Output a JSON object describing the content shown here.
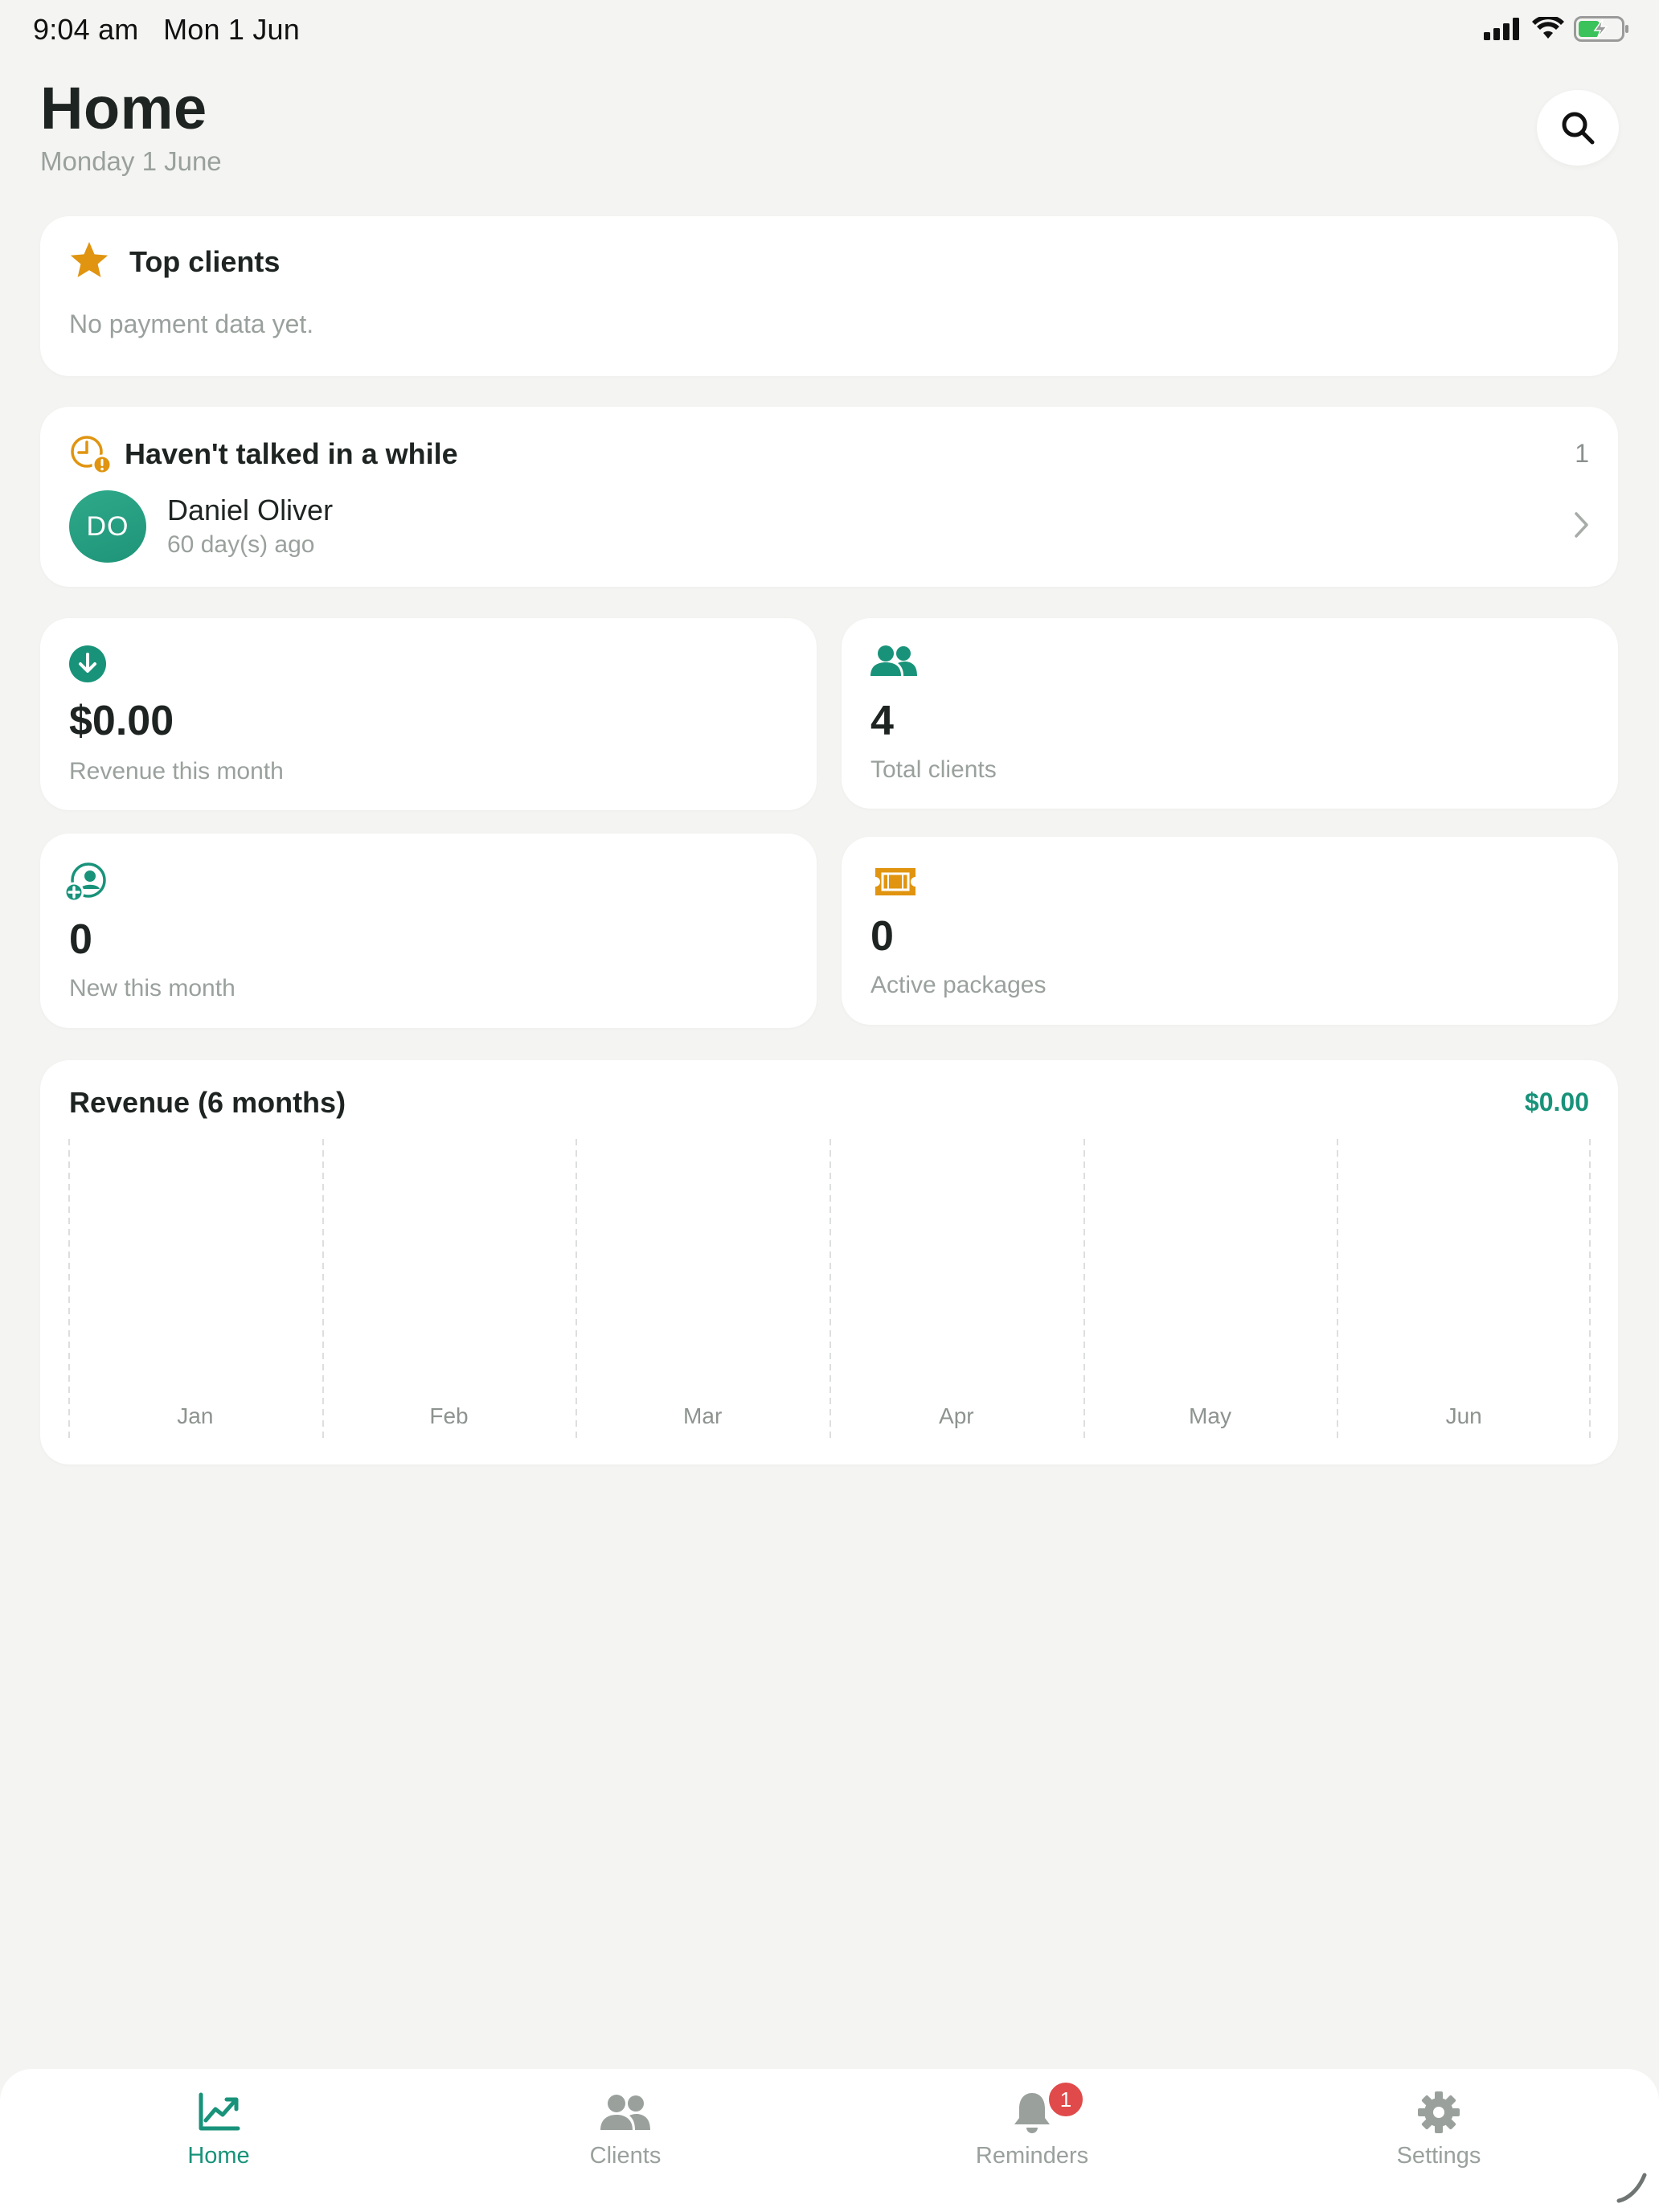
{
  "status_bar": {
    "time": "9:04 am",
    "date": "Mon 1 Jun",
    "icons": [
      "cellular-signal-icon",
      "wifi-icon",
      "battery-charging-icon"
    ]
  },
  "header": {
    "title": "Home",
    "subtitle": "Monday 1 June",
    "search_icon": "search-icon"
  },
  "top_clients": {
    "title": "Top clients",
    "empty_text": "No payment data yet.",
    "icon": "star-icon"
  },
  "havent_talked": {
    "title": "Haven't talked in a while",
    "count": "1",
    "icon": "clock-alert-icon",
    "clients": [
      {
        "initials": "DO",
        "name": "Daniel Oliver",
        "since": "60 day(s) ago"
      }
    ]
  },
  "stats": [
    {
      "icon": "arrow-down-circle-icon",
      "value": "$0.00",
      "label": "Revenue this month"
    },
    {
      "icon": "people-icon",
      "value": "4",
      "label": "Total clients"
    },
    {
      "icon": "person-add-icon",
      "value": "0",
      "label": "New this month"
    },
    {
      "icon": "ticket-icon",
      "value": "0",
      "label": "Active packages"
    }
  ],
  "revenue_chart": {
    "title": "Revenue (6 months)",
    "total": "$0.00"
  },
  "chart_data": {
    "type": "bar",
    "title": "Revenue (6 months)",
    "categories": [
      "Jan",
      "Feb",
      "Mar",
      "Apr",
      "May",
      "Jun"
    ],
    "values": [
      0,
      0,
      0,
      0,
      0,
      0
    ],
    "grid": "vertical-dashed"
  },
  "tab_bar": {
    "tabs": [
      {
        "label": "Home",
        "icon": "chart-trend-icon",
        "active": true
      },
      {
        "label": "Clients",
        "icon": "people-icon",
        "active": false
      },
      {
        "label": "Reminders",
        "icon": "bell-icon",
        "active": false,
        "badge": "1"
      },
      {
        "label": "Settings",
        "icon": "gear-icon",
        "active": false
      }
    ]
  },
  "colors": {
    "accent": "#18937a",
    "orange": "#e0940f",
    "background": "#f4f4f2",
    "badge": "#e04a4a"
  }
}
